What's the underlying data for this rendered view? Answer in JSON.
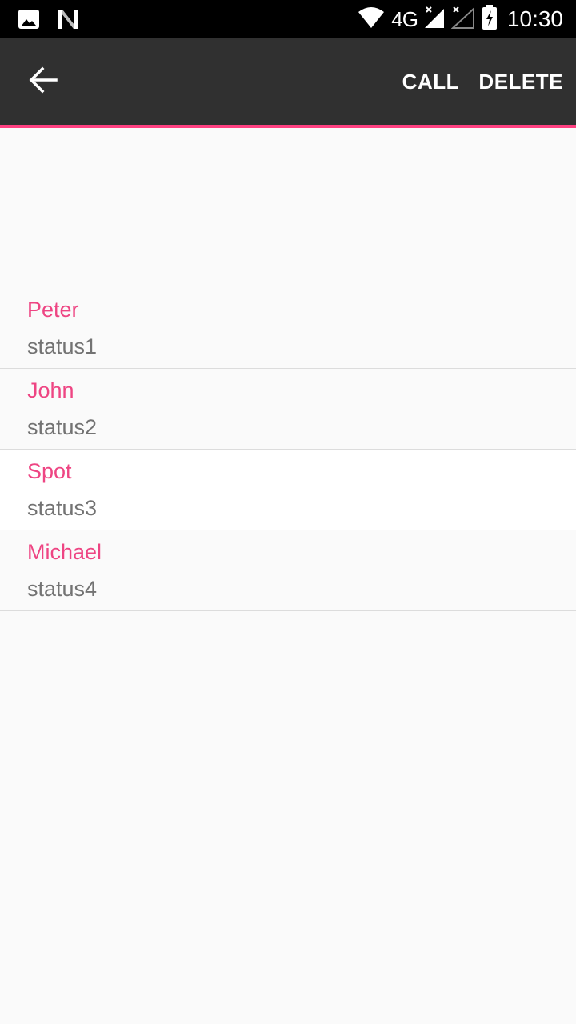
{
  "status_bar": {
    "network": "4G",
    "time": "10:30",
    "icons": [
      "image-icon",
      "n-notification-icon",
      "wifi-icon",
      "cell-signal-icon",
      "cell-signal-2-icon",
      "battery-charging-icon"
    ]
  },
  "app_bar": {
    "back_icon": "arrow-back-icon",
    "actions": {
      "call": "CALL",
      "delete": "DELETE"
    },
    "accent_color": "#ff4081",
    "background_color": "#303030"
  },
  "contacts": [
    {
      "name": "Peter",
      "status": "status1"
    },
    {
      "name": "John",
      "status": "status2"
    },
    {
      "name": "Spot",
      "status": "status3"
    },
    {
      "name": "Michael",
      "status": "status4"
    }
  ],
  "colors": {
    "name_text": "#ee4583",
    "status_text": "#737373",
    "divider": "#dcdcdc"
  }
}
